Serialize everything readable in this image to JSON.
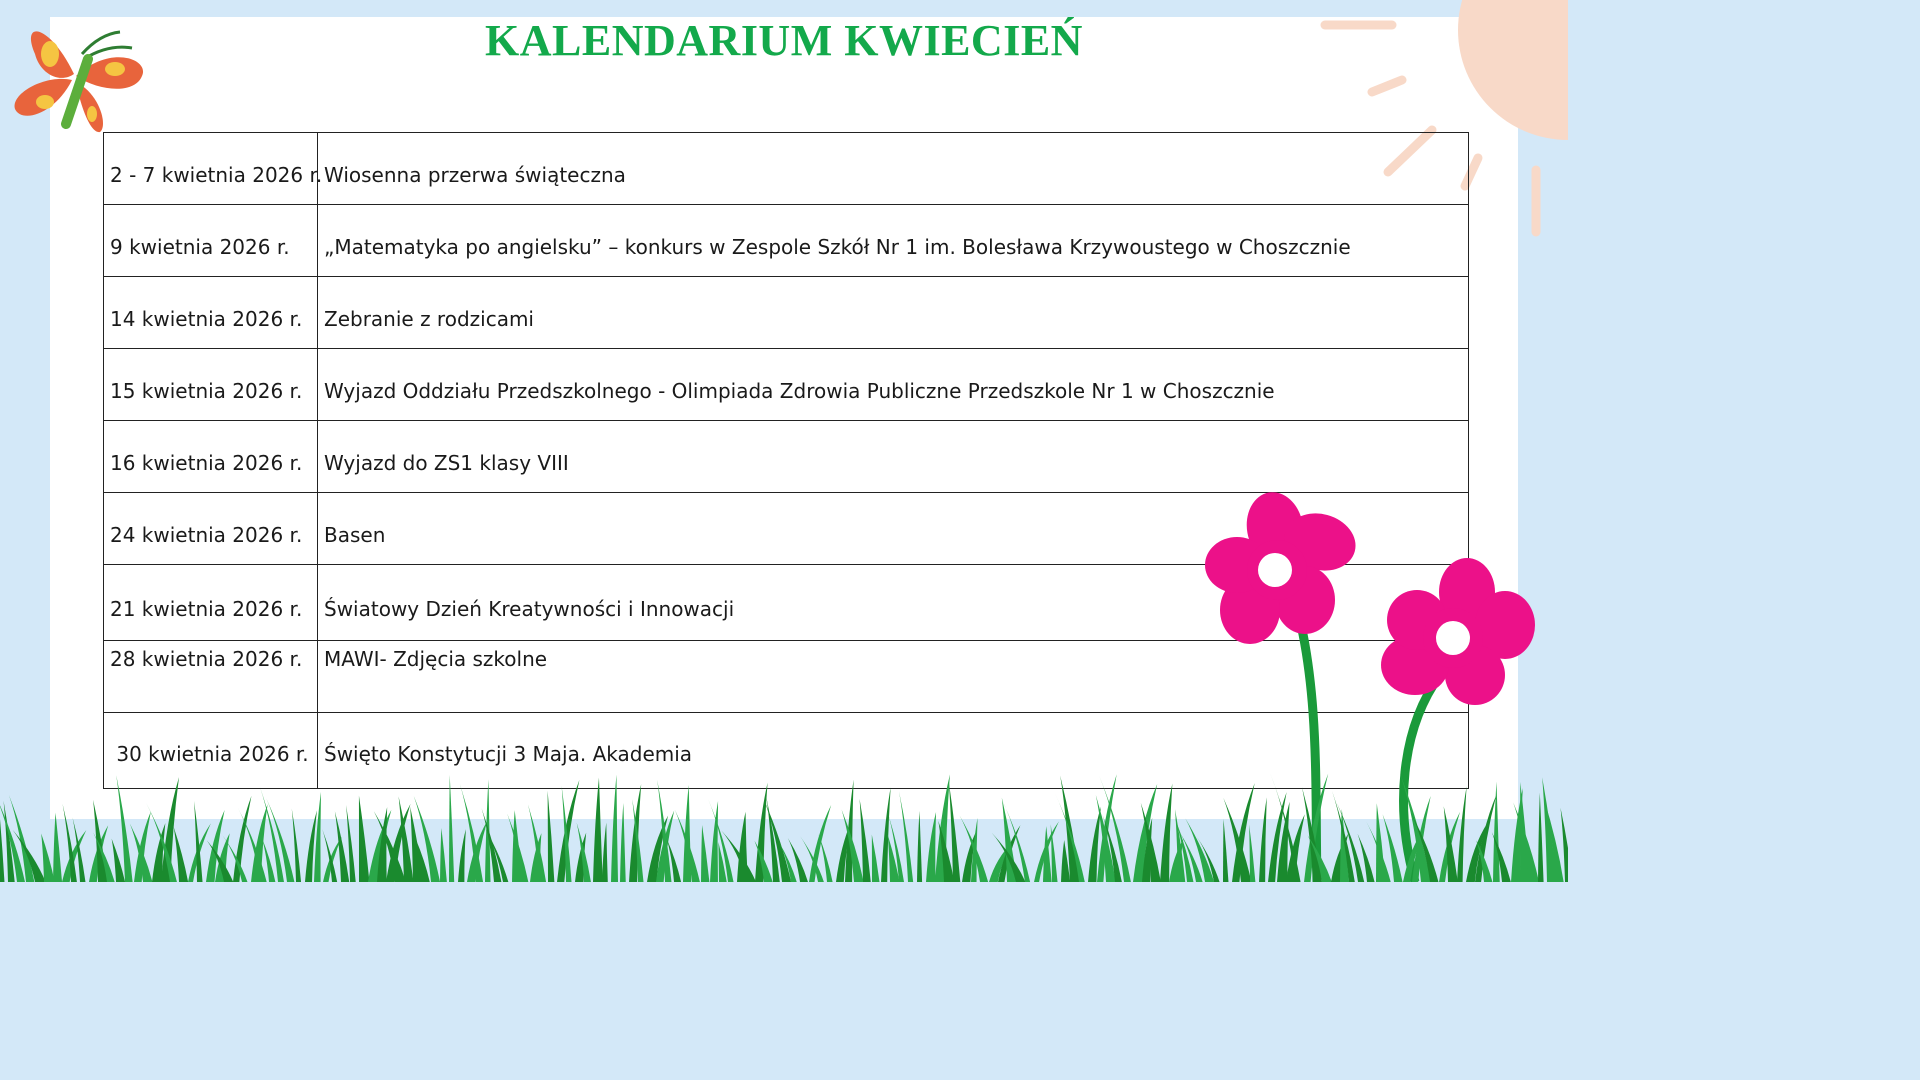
{
  "title": "KALENDARIUM KWIECIEŃ",
  "events": [
    {
      "date": "2 - 7 kwietnia 2026 r.",
      "event": "Wiosenna przerwa świąteczna"
    },
    {
      "date": "9 kwietnia 2026 r.",
      "event": "„Matematyka po angielsku” – konkurs w  Zespole Szkół Nr 1 im. Bolesława Krzywoustego w Choszcznie"
    },
    {
      "date": "14 kwietnia 2026 r.",
      "event": "Zebranie z rodzicami"
    },
    {
      "date": "15 kwietnia 2026 r.",
      "event": "Wyjazd Oddziału Przedszkolnego - Olimpiada Zdrowia Publiczne Przedszkole Nr 1 w Choszcznie"
    },
    {
      "date": "16 kwietnia 2026 r.",
      "event": "Wyjazd do ZS1 klasy VIII"
    },
    {
      "date": "24 kwietnia 2026 r.",
      "event": "Basen"
    },
    {
      "date": "21 kwietnia 2026 r.",
      "event": "Światowy Dzień Kreatywności i Innowacji"
    },
    {
      "date": "28 kwietnia 2026 r.",
      "event": "MAWI- Zdjęcia szkolne"
    },
    {
      "date": " 30 kwietnia 2026 r.",
      "event": "Święto Konstytucji 3 Maja. Akademia"
    }
  ],
  "colors": {
    "title": "#13a94b",
    "background": "#d3e8f8",
    "flower": "#ec1189",
    "grass": "#1a8a2e",
    "butterfly": "#e8643c",
    "sun": "#f8d9c8"
  }
}
